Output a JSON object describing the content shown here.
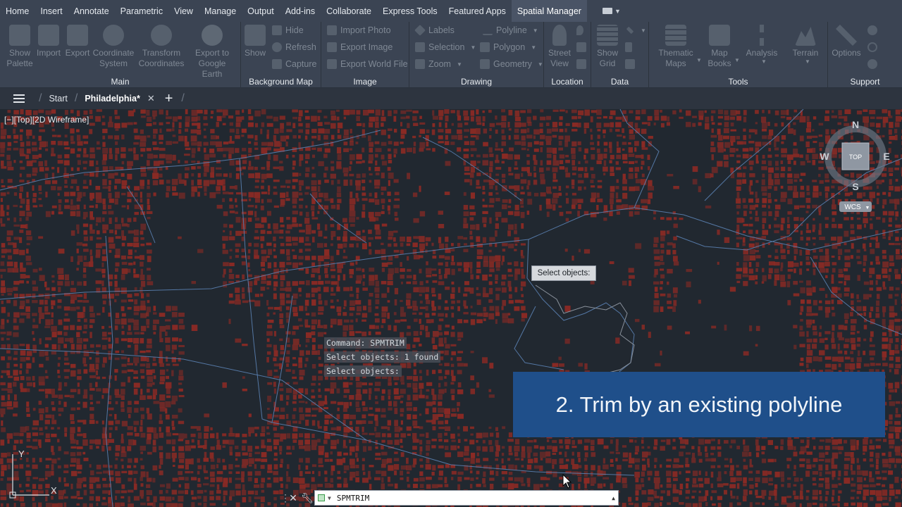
{
  "menu": {
    "tabs": [
      "Home",
      "Insert",
      "Annotate",
      "Parametric",
      "View",
      "Manage",
      "Output",
      "Add-ins",
      "Collaborate",
      "Express Tools",
      "Featured Apps",
      "Spatial Manager"
    ],
    "active": "Spatial Manager"
  },
  "ribbon": {
    "main": {
      "title": "Main",
      "buttons": [
        "Show\nPalette",
        "Import",
        "Export",
        "Coordinate\nSystem",
        "Transform\nCoordinates",
        "Export to\nGoogle Earth"
      ]
    },
    "background_map": {
      "title": "Background Map",
      "show": "Show",
      "hide": "Hide",
      "refresh": "Refresh",
      "capture": "Capture"
    },
    "image": {
      "title": "Image",
      "import_photo": "Import Photo",
      "export_image": "Export Image",
      "export_world_file": "Export World File"
    },
    "drawing": {
      "title": "Drawing",
      "labels": "Labels",
      "selection": "Selection",
      "zoom": "Zoom",
      "polyline": "Polyline",
      "polygon": "Polygon",
      "geometry": "Geometry"
    },
    "location": {
      "title": "Location",
      "street_view": "Street\nView"
    },
    "data": {
      "title": "Data",
      "show_grid": "Show\nGrid"
    },
    "tools": {
      "title": "Tools",
      "thematic_maps": "Thematic\nMaps",
      "map_books": "Map\nBooks",
      "analysis": "Analysis",
      "terrain": "Terrain"
    },
    "support": {
      "title": "Support",
      "options": "Options"
    }
  },
  "filetabs": {
    "start": "Start",
    "current": "Philadelphia*"
  },
  "viewport": {
    "label": "[−][Top][2D Wireframe]",
    "tooltip": "Select objects:",
    "banner": "2. Trim by an existing polyline",
    "viewcube": {
      "n": "N",
      "s": "S",
      "e": "E",
      "w": "W",
      "face": "TOP",
      "wcs": "WCS"
    }
  },
  "command": {
    "history": [
      "Command: SPMTRIM",
      "Select objects: 1 found",
      "Select objects:"
    ],
    "input": "SPMTRIM"
  },
  "ucs": {
    "y": "Y",
    "x": "X"
  },
  "colors": {
    "building": "#8a2a24",
    "background": "#212830",
    "boundary": "#5a7fb0",
    "banner": "#1f4f8a",
    "ribbon": "#3b4453"
  }
}
